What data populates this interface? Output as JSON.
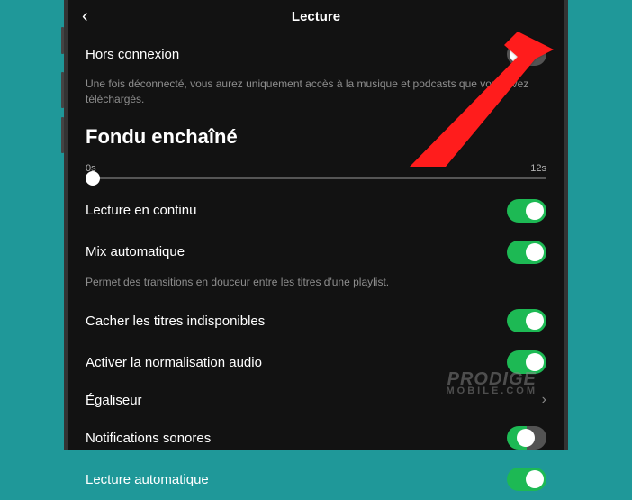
{
  "header": {
    "title": "Lecture"
  },
  "offline": {
    "label": "Hors connexion",
    "description": "Une fois déconnecté, vous aurez uniquement accès à la musique et podcasts que vous avez téléchargés."
  },
  "crossfade": {
    "title": "Fondu enchaîné",
    "min": "0s",
    "max": "12s"
  },
  "items": [
    {
      "label": "Lecture en continu",
      "on": true
    },
    {
      "label": "Mix automatique",
      "on": true,
      "desc": "Permet des transitions en douceur entre les titres d'une playlist."
    },
    {
      "label": "Cacher les titres indisponibles",
      "on": true
    },
    {
      "label": "Activer la normalisation audio",
      "on": true
    },
    {
      "label": "Égaliseur",
      "chevron": true
    },
    {
      "label": "Notifications sonores",
      "half": true
    },
    {
      "label": "Lecture automatique",
      "on": true
    }
  ],
  "watermark": {
    "main": "PRODIGE",
    "sub": "MOBILE.COM"
  }
}
